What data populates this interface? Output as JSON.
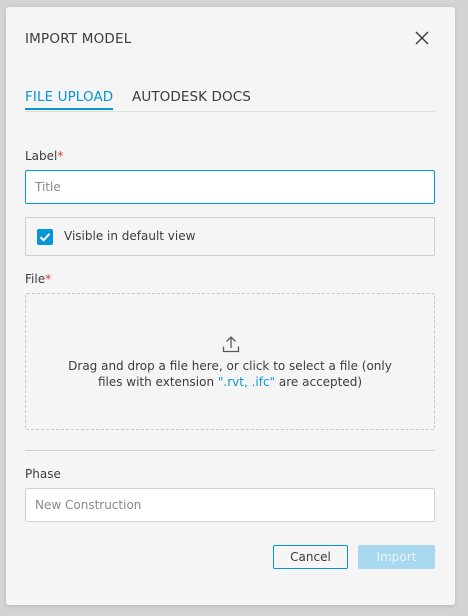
{
  "dialog": {
    "title": "IMPORT MODEL",
    "close_icon": "close-icon"
  },
  "tabs": [
    {
      "label": "FILE UPLOAD",
      "active": true
    },
    {
      "label": "AUTODESK DOCS",
      "active": false
    }
  ],
  "label_field": {
    "label": "Label",
    "required_mark": "*",
    "value": "",
    "placeholder": "Title"
  },
  "visibility": {
    "checked": true,
    "label": "Visible in default view"
  },
  "file_field": {
    "label": "File",
    "required_mark": "*",
    "upload_icon": "upload-icon",
    "drop_text_1": "Drag and drop a file here, or click to select a file (only",
    "drop_text_2_before": "files with extension ",
    "extensions": "\".rvt, .ifc\"",
    "drop_text_2_after": " are accepted)"
  },
  "phase_field": {
    "label": "Phase",
    "value": "New Construction"
  },
  "buttons": {
    "cancel_label": "Cancel",
    "import_label": "Import",
    "import_enabled": false
  },
  "colors": {
    "accent": "#0696d7",
    "required": "#e0393e",
    "disabled_button": "#a8d8ef"
  }
}
